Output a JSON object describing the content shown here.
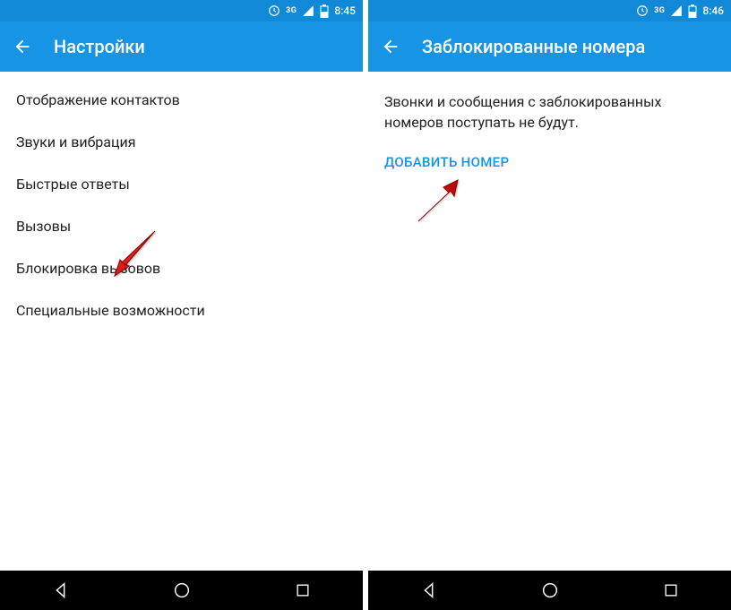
{
  "left": {
    "statusbar": {
      "network": "3G",
      "time": "8:45"
    },
    "appbar": {
      "title": "Настройки"
    },
    "items": [
      "Отображение контактов",
      "Звуки и вибрация",
      "Быстрые ответы",
      "Вызовы",
      "Блокировка вызовов",
      "Специальные возможности"
    ]
  },
  "right": {
    "statusbar": {
      "network": "3G",
      "time": "8:46"
    },
    "appbar": {
      "title": "Заблокированные номера"
    },
    "description": "Звонки и сообщения с заблокированных номеров поступать не будут.",
    "action": "ДОБАВИТЬ НОМЕР"
  }
}
